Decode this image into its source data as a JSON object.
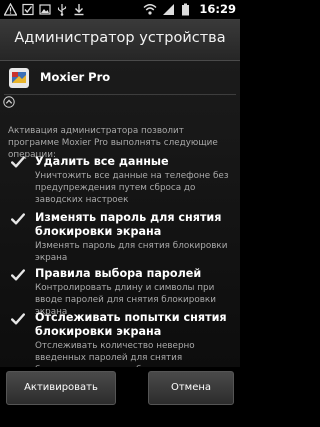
{
  "status_bar": {
    "time": "16:29",
    "icons": [
      "warning-icon",
      "checkbox-icon",
      "photo-icon",
      "usb-icon",
      "download-icon",
      "wifi-icon",
      "signal-icon",
      "battery-icon"
    ]
  },
  "header": {
    "title": "Администратор устройства"
  },
  "app": {
    "name": "Moxier Pro"
  },
  "description": "Активация администратора позволит программе Moxier Pro выполнять следующие операции:",
  "permissions": [
    {
      "title": "Удалить все данные",
      "description": "Уничтожить все данные на телефоне без предупреждения путем сброса до заводских настроек"
    },
    {
      "title": "Изменять пароль для снятия блокировки экрана",
      "description": "Изменять пароль для снятия блокировки экрана"
    },
    {
      "title": "Правила выбора паролей",
      "description": "Контролировать длину и символы при вводе паролей для снятия блокировки экрана"
    },
    {
      "title": "Отслеживать попытки снятия блокировки экрана",
      "description": "Отслеживать количество неверно введенных паролей для снятия блокировки экрана и блокировать телефон либо уничтожить все данные на нем, если было введено слишком много неверных паролей"
    }
  ],
  "buttons": {
    "activate": "Активировать",
    "cancel": "Отмена"
  }
}
